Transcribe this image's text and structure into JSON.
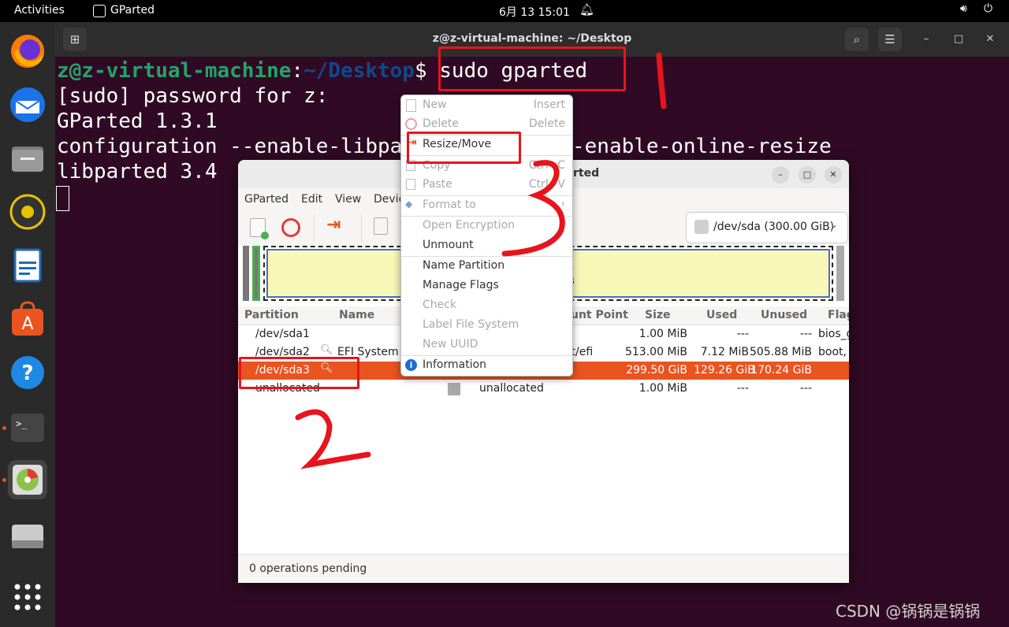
{
  "topbar": {
    "activities": "Activities",
    "app": "GParted",
    "clock": "6月 13  15:01"
  },
  "terminal": {
    "title": "z@z-virtual-machine: ~/Desktop",
    "prompt_user": "z@z-virtual-machine",
    "prompt_colon": ":",
    "prompt_path": "~/Desktop",
    "prompt_dollar": "$ ",
    "command": "sudo gparted",
    "lines": [
      "[sudo] password for z:",
      "GParted 1.3.1",
      "configuration --enable-libpa",
      "-enable-online-resize",
      "libparted 3.4"
    ]
  },
  "gparted": {
    "title_partial": "rted",
    "menu": [
      "GParted",
      "Edit",
      "View",
      "Devic"
    ],
    "device": "/dev/sda (300.00 GiB)",
    "map_lines": [
      "3",
      "B"
    ],
    "columns": {
      "partition": "Partition",
      "name": "Name",
      "mount": "unt Point",
      "size": "Size",
      "used": "Used",
      "unused": "Unused",
      "flags": "Flag"
    },
    "rows": [
      {
        "partition": "/dev/sda1",
        "name": "",
        "mount": "",
        "size": "1.00 MiB",
        "used": "---",
        "unused": "---",
        "flags": "bios_g"
      },
      {
        "partition": "/dev/sda2",
        "name": "EFI System P",
        "mount": "ot/efi",
        "size": "513.00 MiB",
        "used": "7.12 MiB",
        "unused": "505.88 MiB",
        "flags": "boot, e"
      },
      {
        "partition": "/dev/sda3",
        "name": "",
        "mount": "",
        "size": "299.50 GiB",
        "used": "129.26 GiB",
        "unused": "170.24 GiB",
        "flags": ""
      },
      {
        "partition": "unallocated",
        "name": "",
        "mount": "unallocated",
        "size": "1.00 MiB",
        "used": "---",
        "unused": "---",
        "flags": ""
      }
    ],
    "status": "0 operations pending"
  },
  "context_menu": {
    "new": "New",
    "new_acc": "Insert",
    "delete": "Delete",
    "delete_acc": "Delete",
    "resize": "Resize/Move",
    "copy": "Copy",
    "copy_acc": "Ctrl+C",
    "paste": "Paste",
    "paste_acc": "Ctrl+V",
    "format": "Format to",
    "open_encryption": "Open Encryption",
    "unmount": "Unmount",
    "name_partition": "Name Partition",
    "manage_flags": "Manage Flags",
    "check": "Check",
    "label_fs": "Label File System",
    "new_uuid": "New UUID",
    "information": "Information"
  },
  "watermark": "CSDN @锅锅是锅锅",
  "annotations": {
    "one": "1",
    "two": "2",
    "three": "3"
  },
  "colors": {
    "accent": "#e95420",
    "terminal_bg": "#300a24",
    "prompt_green": "#26a269",
    "prompt_blue": "#12488b",
    "highlight": "#e8141c"
  }
}
